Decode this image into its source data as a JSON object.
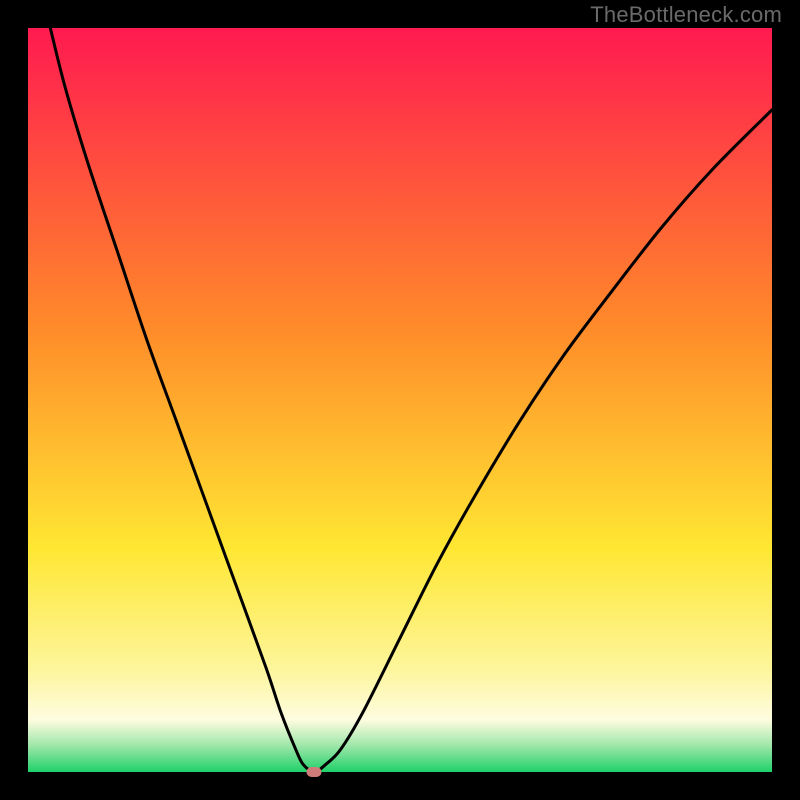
{
  "watermark": "TheBottleneck.com",
  "colors": {
    "frame": "#000000",
    "watermark": "#6a6a6a",
    "curve": "#000000",
    "marker": "#cf7b7a"
  },
  "chart_data": {
    "type": "line",
    "title": "",
    "xlabel": "",
    "ylabel": "",
    "xlim": [
      0,
      100
    ],
    "ylim": [
      0,
      100
    ],
    "gradient_stops": [
      {
        "pos": 0.0,
        "color": "#ff1a50"
      },
      {
        "pos": 0.4,
        "color": "#ff8a2a"
      },
      {
        "pos": 0.7,
        "color": "#ffe733"
      },
      {
        "pos": 0.86,
        "color": "#fdf59a"
      },
      {
        "pos": 0.93,
        "color": "#fefce0"
      },
      {
        "pos": 0.965,
        "color": "#9de6a8"
      },
      {
        "pos": 1.0,
        "color": "#1fd169"
      }
    ],
    "series": [
      {
        "name": "bottleneck-curve",
        "x": [
          3,
          5,
          8,
          12,
          16,
          20,
          24,
          28,
          32,
          34,
          36,
          37,
          38.5,
          40,
          42,
          45,
          50,
          55,
          60,
          66,
          72,
          78,
          85,
          92,
          100
        ],
        "y": [
          100,
          92,
          82,
          70,
          58,
          47,
          36,
          25,
          14,
          8,
          3,
          1,
          0,
          1,
          3,
          8,
          18,
          28,
          37,
          47,
          56,
          64,
          73,
          81,
          89
        ]
      }
    ],
    "marker": {
      "x": 38.5,
      "y": 0
    }
  }
}
